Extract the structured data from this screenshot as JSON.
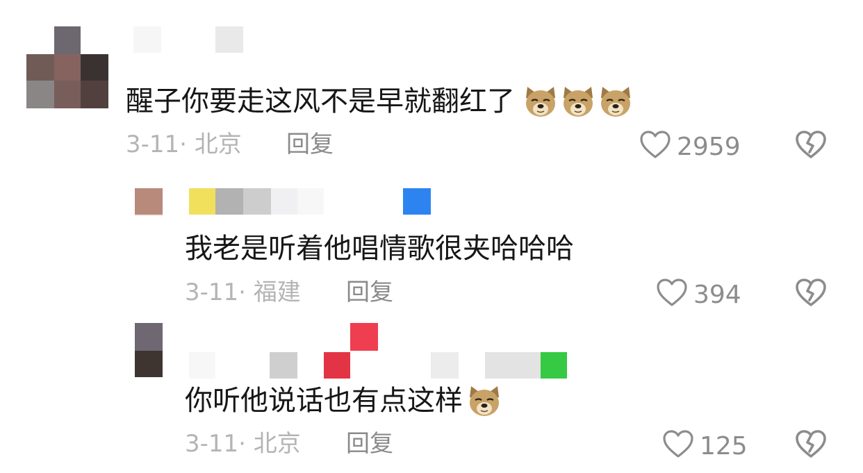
{
  "comments": [
    {
      "text": "醒子你要走这风不是早就翻红了",
      "emoji_count": 3,
      "date": "3-11",
      "location": "北京",
      "reply_label": "回复",
      "likes": "2959"
    },
    {
      "text": "我老是听着他唱情歌很夹哈哈哈",
      "emoji_count": 0,
      "date": "3-11",
      "location": "福建",
      "reply_label": "回复",
      "likes": "394"
    },
    {
      "text": "你听他说话也有点这样",
      "emoji_count": 1,
      "date": "3-11",
      "location": "北京",
      "reply_label": "回复",
      "likes": "125"
    }
  ],
  "icons": {
    "like": "heart-outline-icon",
    "dislike": "broken-heart-icon",
    "emoji": "dog-face-emoji-icon"
  },
  "colors": {
    "text": "#161616",
    "meta": "#b4b4b4",
    "reply": "#8a8a8a",
    "icon": "#8c8c8c"
  }
}
